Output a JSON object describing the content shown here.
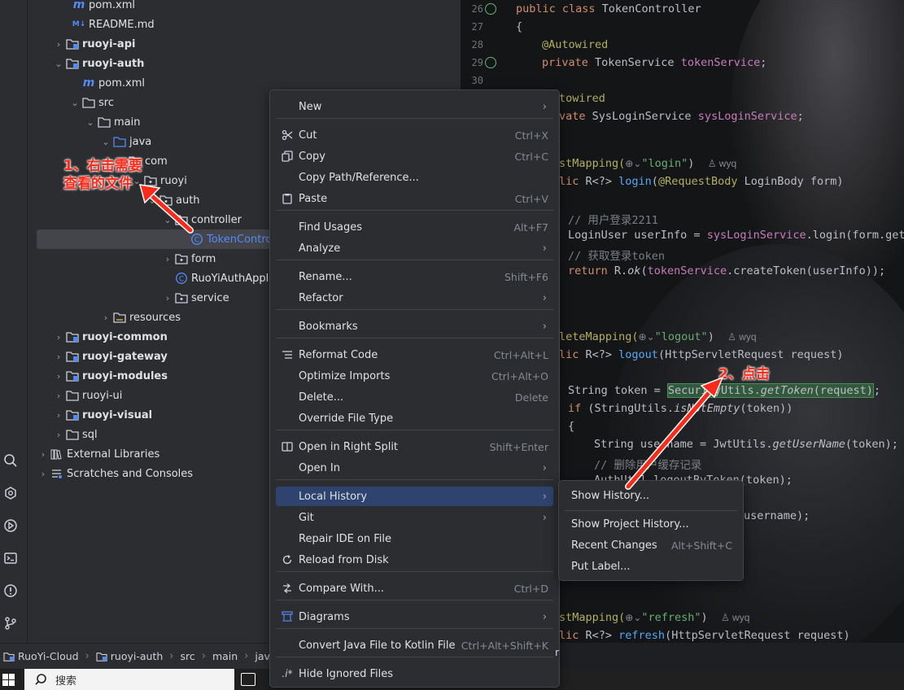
{
  "tree": {
    "items": [
      {
        "label": "pom.xml",
        "type": "maven"
      },
      {
        "label": "README.md",
        "type": "md"
      },
      {
        "label": "ruoyi-api",
        "type": "module"
      },
      {
        "label": "ruoyi-auth",
        "type": "module"
      },
      {
        "label": "pom.xml",
        "type": "maven"
      },
      {
        "label": "src",
        "type": "folder"
      },
      {
        "label": "main",
        "type": "folder"
      },
      {
        "label": "java",
        "type": "source"
      },
      {
        "label": "com",
        "type": "package"
      },
      {
        "label": "ruoyi",
        "type": "package"
      },
      {
        "label": "auth",
        "type": "package"
      },
      {
        "label": "controller",
        "type": "package"
      },
      {
        "label": "TokenContro",
        "type": "class"
      },
      {
        "label": "form",
        "type": "package"
      },
      {
        "label": "RuoYiAuthApplic",
        "type": "class"
      },
      {
        "label": "service",
        "type": "package"
      },
      {
        "label": "resources",
        "type": "resources"
      },
      {
        "label": "ruoyi-common",
        "type": "module"
      },
      {
        "label": "ruoyi-gateway",
        "type": "module"
      },
      {
        "label": "ruoyi-modules",
        "type": "module"
      },
      {
        "label": "ruoyi-ui",
        "type": "folder"
      },
      {
        "label": "ruoyi-visual",
        "type": "module"
      },
      {
        "label": "sql",
        "type": "folder"
      },
      {
        "label": "External Libraries",
        "type": "lib"
      },
      {
        "label": "Scratches and Consoles",
        "type": "scratch"
      }
    ]
  },
  "editor": {
    "line_numbers": [
      "26",
      "27",
      "28",
      "29",
      "30"
    ],
    "author": "wyq",
    "class_decl": "public class TokenController",
    "lines": {
      "autowired1": "@Autowired",
      "field1_type": "private TokenService ",
      "field1_name": "tokenService",
      "autowired2": "towired",
      "field2_type": "vate SysLoginService ",
      "field2_name": "sysLoginService",
      "post_mapping": "stMapping(",
      "login_path": "\"login\"",
      "login_sig": "lic R<?> login(@RequestBody LoginBody form)",
      "comment1": "// 用户登录2211",
      "login_user": "LoginUser userInfo = sysLoginService.login(form.getU",
      "comment2": "// 获取登录token",
      "return_line": "return R.ok(tokenService.createToken(userInfo));",
      "delete_mapping": "leteMapping(",
      "logout_path": "\"logout\"",
      "logout_sig": "lic R<?> logout(HttpServletRequest request)",
      "token_line_a": "String token = ",
      "token_line_hl": "SecurityUtils.getToken(request)",
      "token_line_b": ";",
      "if_line": "if (StringUtils.isNotEmpty(token))",
      "brace": "{",
      "username_line": "String username = JwtUtils.getUserName(token);",
      "comment3": "// 删除用户缓存记录",
      "authutil_line": "AuthUtil.logoutByToken(token);",
      "username_tail": "username);",
      "refresh_mapping": "stMapping(",
      "refresh_path": "\"refresh\"",
      "refresh_sig": "lic R<?> refresh(HttpServletRequest request)"
    }
  },
  "breadcrumb": [
    "RuoYi-Cloud",
    "ruoyi-auth",
    "src",
    "main",
    "java"
  ],
  "breadcrumb_tail": "r",
  "context_menu": {
    "items": [
      {
        "label": "New",
        "shortcut": "",
        "submenu": true,
        "icon": ""
      },
      {
        "label": "Cut",
        "shortcut": "Ctrl+X",
        "submenu": false,
        "icon": "scissors-icon"
      },
      {
        "label": "Copy",
        "shortcut": "Ctrl+C",
        "submenu": false,
        "icon": "copy-icon"
      },
      {
        "label": "Copy Path/Reference...",
        "shortcut": "",
        "submenu": false,
        "icon": ""
      },
      {
        "label": "Paste",
        "shortcut": "Ctrl+V",
        "submenu": false,
        "icon": "paste-icon"
      },
      {
        "label": "Find Usages",
        "shortcut": "Alt+F7",
        "submenu": false,
        "icon": ""
      },
      {
        "label": "Analyze",
        "shortcut": "",
        "submenu": true,
        "icon": ""
      },
      {
        "label": "Rename...",
        "shortcut": "Shift+F6",
        "submenu": false,
        "icon": ""
      },
      {
        "label": "Refactor",
        "shortcut": "",
        "submenu": true,
        "icon": ""
      },
      {
        "label": "Bookmarks",
        "shortcut": "",
        "submenu": true,
        "icon": ""
      },
      {
        "label": "Reformat Code",
        "shortcut": "Ctrl+Alt+L",
        "submenu": false,
        "icon": "reformat-icon"
      },
      {
        "label": "Optimize Imports",
        "shortcut": "Ctrl+Alt+O",
        "submenu": false,
        "icon": ""
      },
      {
        "label": "Delete...",
        "shortcut": "Delete",
        "submenu": false,
        "icon": ""
      },
      {
        "label": "Override File Type",
        "shortcut": "",
        "submenu": false,
        "icon": ""
      },
      {
        "label": "Open in Right Split",
        "shortcut": "Shift+Enter",
        "submenu": false,
        "icon": "split-icon"
      },
      {
        "label": "Open In",
        "shortcut": "",
        "submenu": true,
        "icon": ""
      },
      {
        "label": "Local History",
        "shortcut": "",
        "submenu": true,
        "icon": ""
      },
      {
        "label": "Git",
        "shortcut": "",
        "submenu": true,
        "icon": ""
      },
      {
        "label": "Repair IDE on File",
        "shortcut": "",
        "submenu": false,
        "icon": ""
      },
      {
        "label": "Reload from Disk",
        "shortcut": "",
        "submenu": false,
        "icon": "reload-icon"
      },
      {
        "label": "Compare With...",
        "shortcut": "Ctrl+D",
        "submenu": false,
        "icon": "compare-icon"
      },
      {
        "label": "Diagrams",
        "shortcut": "",
        "submenu": true,
        "icon": "diagram-icon"
      },
      {
        "label": "Convert Java File to Kotlin File",
        "shortcut": "Ctrl+Alt+Shift+K",
        "submenu": false,
        "icon": ""
      },
      {
        "label": "Hide Ignored Files",
        "shortcut": "",
        "submenu": false,
        "icon": "ignored-files-icon"
      }
    ]
  },
  "submenu": {
    "items": [
      {
        "label": "Show History...",
        "shortcut": ""
      },
      {
        "label": "Show Project History...",
        "shortcut": ""
      },
      {
        "label": "Recent Changes",
        "shortcut": "Alt+Shift+C"
      },
      {
        "label": "Put Label...",
        "shortcut": ""
      }
    ]
  },
  "annotations": {
    "step1_line1": "1、右击需要",
    "step1_line2": "查看的文件",
    "step2": "2、点击"
  },
  "taskbar": {
    "search_placeholder": "搜索"
  },
  "colors": {
    "accent": "#2e436e",
    "annotation": "#ff2a1a",
    "background": "#2b2d30"
  }
}
